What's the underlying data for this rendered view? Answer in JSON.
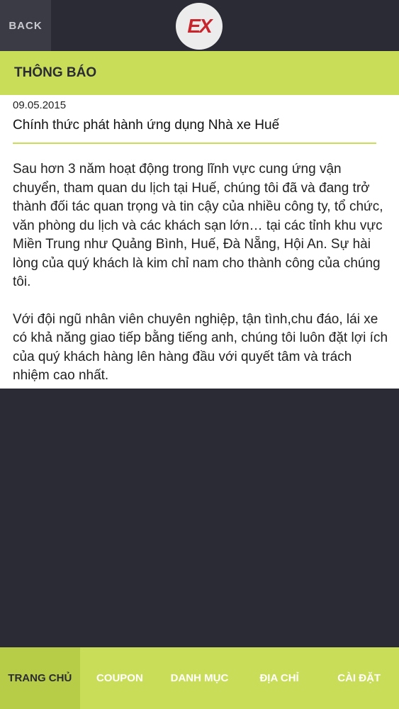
{
  "topbar": {
    "back_label": "BACK",
    "logo_text": "EX"
  },
  "section": {
    "title": "THÔNG BÁO"
  },
  "article": {
    "date": "09.05.2015",
    "headline": "Chính thức phát hành ứng dụng Nhà xe Huế",
    "paragraphs": [
      "Sau hơn 3 năm hoạt động trong lĩnh vực cung ứng vận chuyển, tham quan du lịch tại Huế, chúng tôi đã và đang trở thành đối tác quan trọng và tin cậy của nhiều công ty, tổ chức,  văn phòng du lịch và các khách sạn lớn… tại các tỉnh khu vực Miền Trung như Quảng Bình, Huế, Đà Nẵng, Hội An. Sự hài lòng của quý khách là kim chỉ nam cho thành công của chúng tôi.",
      "Với đội ngũ nhân viên chuyên nghiệp, tận tình,chu đáo, lái xe có khả năng giao tiếp bằng tiếng anh, chúng tôi luôn đặt lợi ích của quý khách hàng lên hàng đầu với quyết tâm và trách nhiệm cao nhất."
    ]
  },
  "tabs": [
    {
      "label": "TRANG CHỦ",
      "active": true
    },
    {
      "label": "COUPON",
      "active": false
    },
    {
      "label": "DANH MỤC",
      "active": false
    },
    {
      "label": "ĐỊA CHỈ",
      "active": false
    },
    {
      "label": "CÀI ĐẶT",
      "active": false
    }
  ],
  "colors": {
    "accent": "#c9dd58",
    "active_tab": "#b7cc47",
    "background": "#2a2b35",
    "logo_red": "#c8252d"
  }
}
